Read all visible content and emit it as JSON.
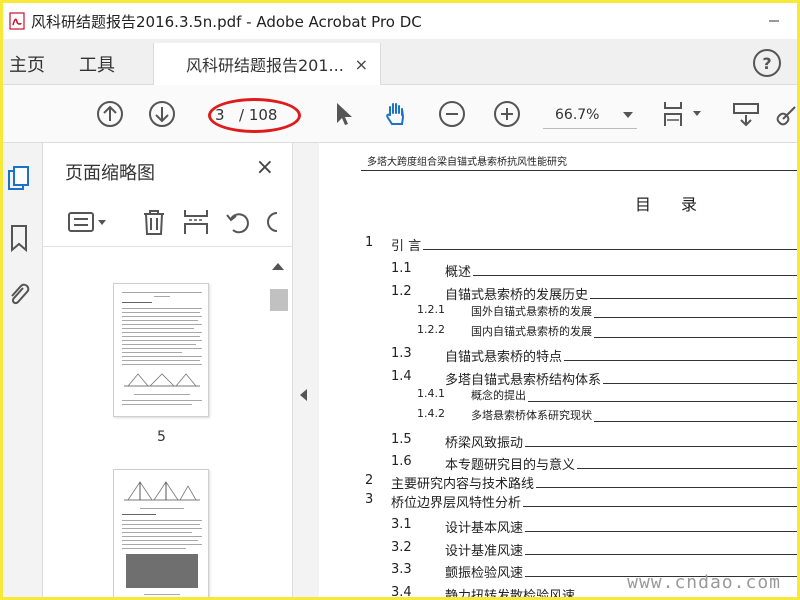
{
  "window": {
    "title": "风科研结题报告2016.3.5n.pdf - Adobe Acrobat Pro DC"
  },
  "tabs": {
    "home": "主页",
    "tools": "工具",
    "document": "风科研结题报告201...",
    "close": "×",
    "help": "?"
  },
  "toolbar": {
    "page_current": "3",
    "page_total": "/ 108",
    "zoom": "66.7%"
  },
  "thumbnails": {
    "title": "页面缩略图",
    "close": "×",
    "page_labels": [
      "5"
    ]
  },
  "document": {
    "header": "多塔大跨度组合梁自锚式悬索桥抗风性能研究",
    "toc_title": "目录",
    "toc": [
      {
        "num": "1",
        "text": "引    言",
        "level": 0
      },
      {
        "num": "1.1",
        "text": "概述",
        "level": 1
      },
      {
        "num": "1.2",
        "text": "自锚式悬索桥的发展历史",
        "level": 1
      },
      {
        "num": "1.2.1",
        "text": "国外自锚式悬索桥的发展",
        "level": 2
      },
      {
        "num": "1.2.2",
        "text": "国内自锚式悬索桥的发展",
        "level": 2
      },
      {
        "num": "1.3",
        "text": "自锚式悬索桥的特点",
        "level": 1
      },
      {
        "num": "1.4",
        "text": "多塔自锚式悬索桥结构体系",
        "level": 1
      },
      {
        "num": "1.4.1",
        "text": "概念的提出",
        "level": 2
      },
      {
        "num": "1.4.2",
        "text": "多塔悬索桥体系研究现状",
        "level": 2
      },
      {
        "num": "1.5",
        "text": "桥梁风致振动",
        "level": 1
      },
      {
        "num": "1.6",
        "text": "本专题研究目的与意义",
        "level": 1
      },
      {
        "num": "2",
        "text": "主要研究内容与技术路线",
        "level": 0
      },
      {
        "num": "3",
        "text": "桥位边界层风特性分析",
        "level": 0
      },
      {
        "num": "3.1",
        "text": "设计基本风速",
        "level": 1
      },
      {
        "num": "3.2",
        "text": "设计基准风速",
        "level": 1
      },
      {
        "num": "3.3",
        "text": "颤振检验风速",
        "level": 1
      },
      {
        "num": "3.4",
        "text": "静力扭转发散检验风速",
        "level": 1
      }
    ]
  },
  "watermark": "www.cndao.com",
  "colors": {
    "frame": "#f6e93a",
    "highlight": "#e01b1b",
    "accent_blue": "#1a73c9"
  }
}
